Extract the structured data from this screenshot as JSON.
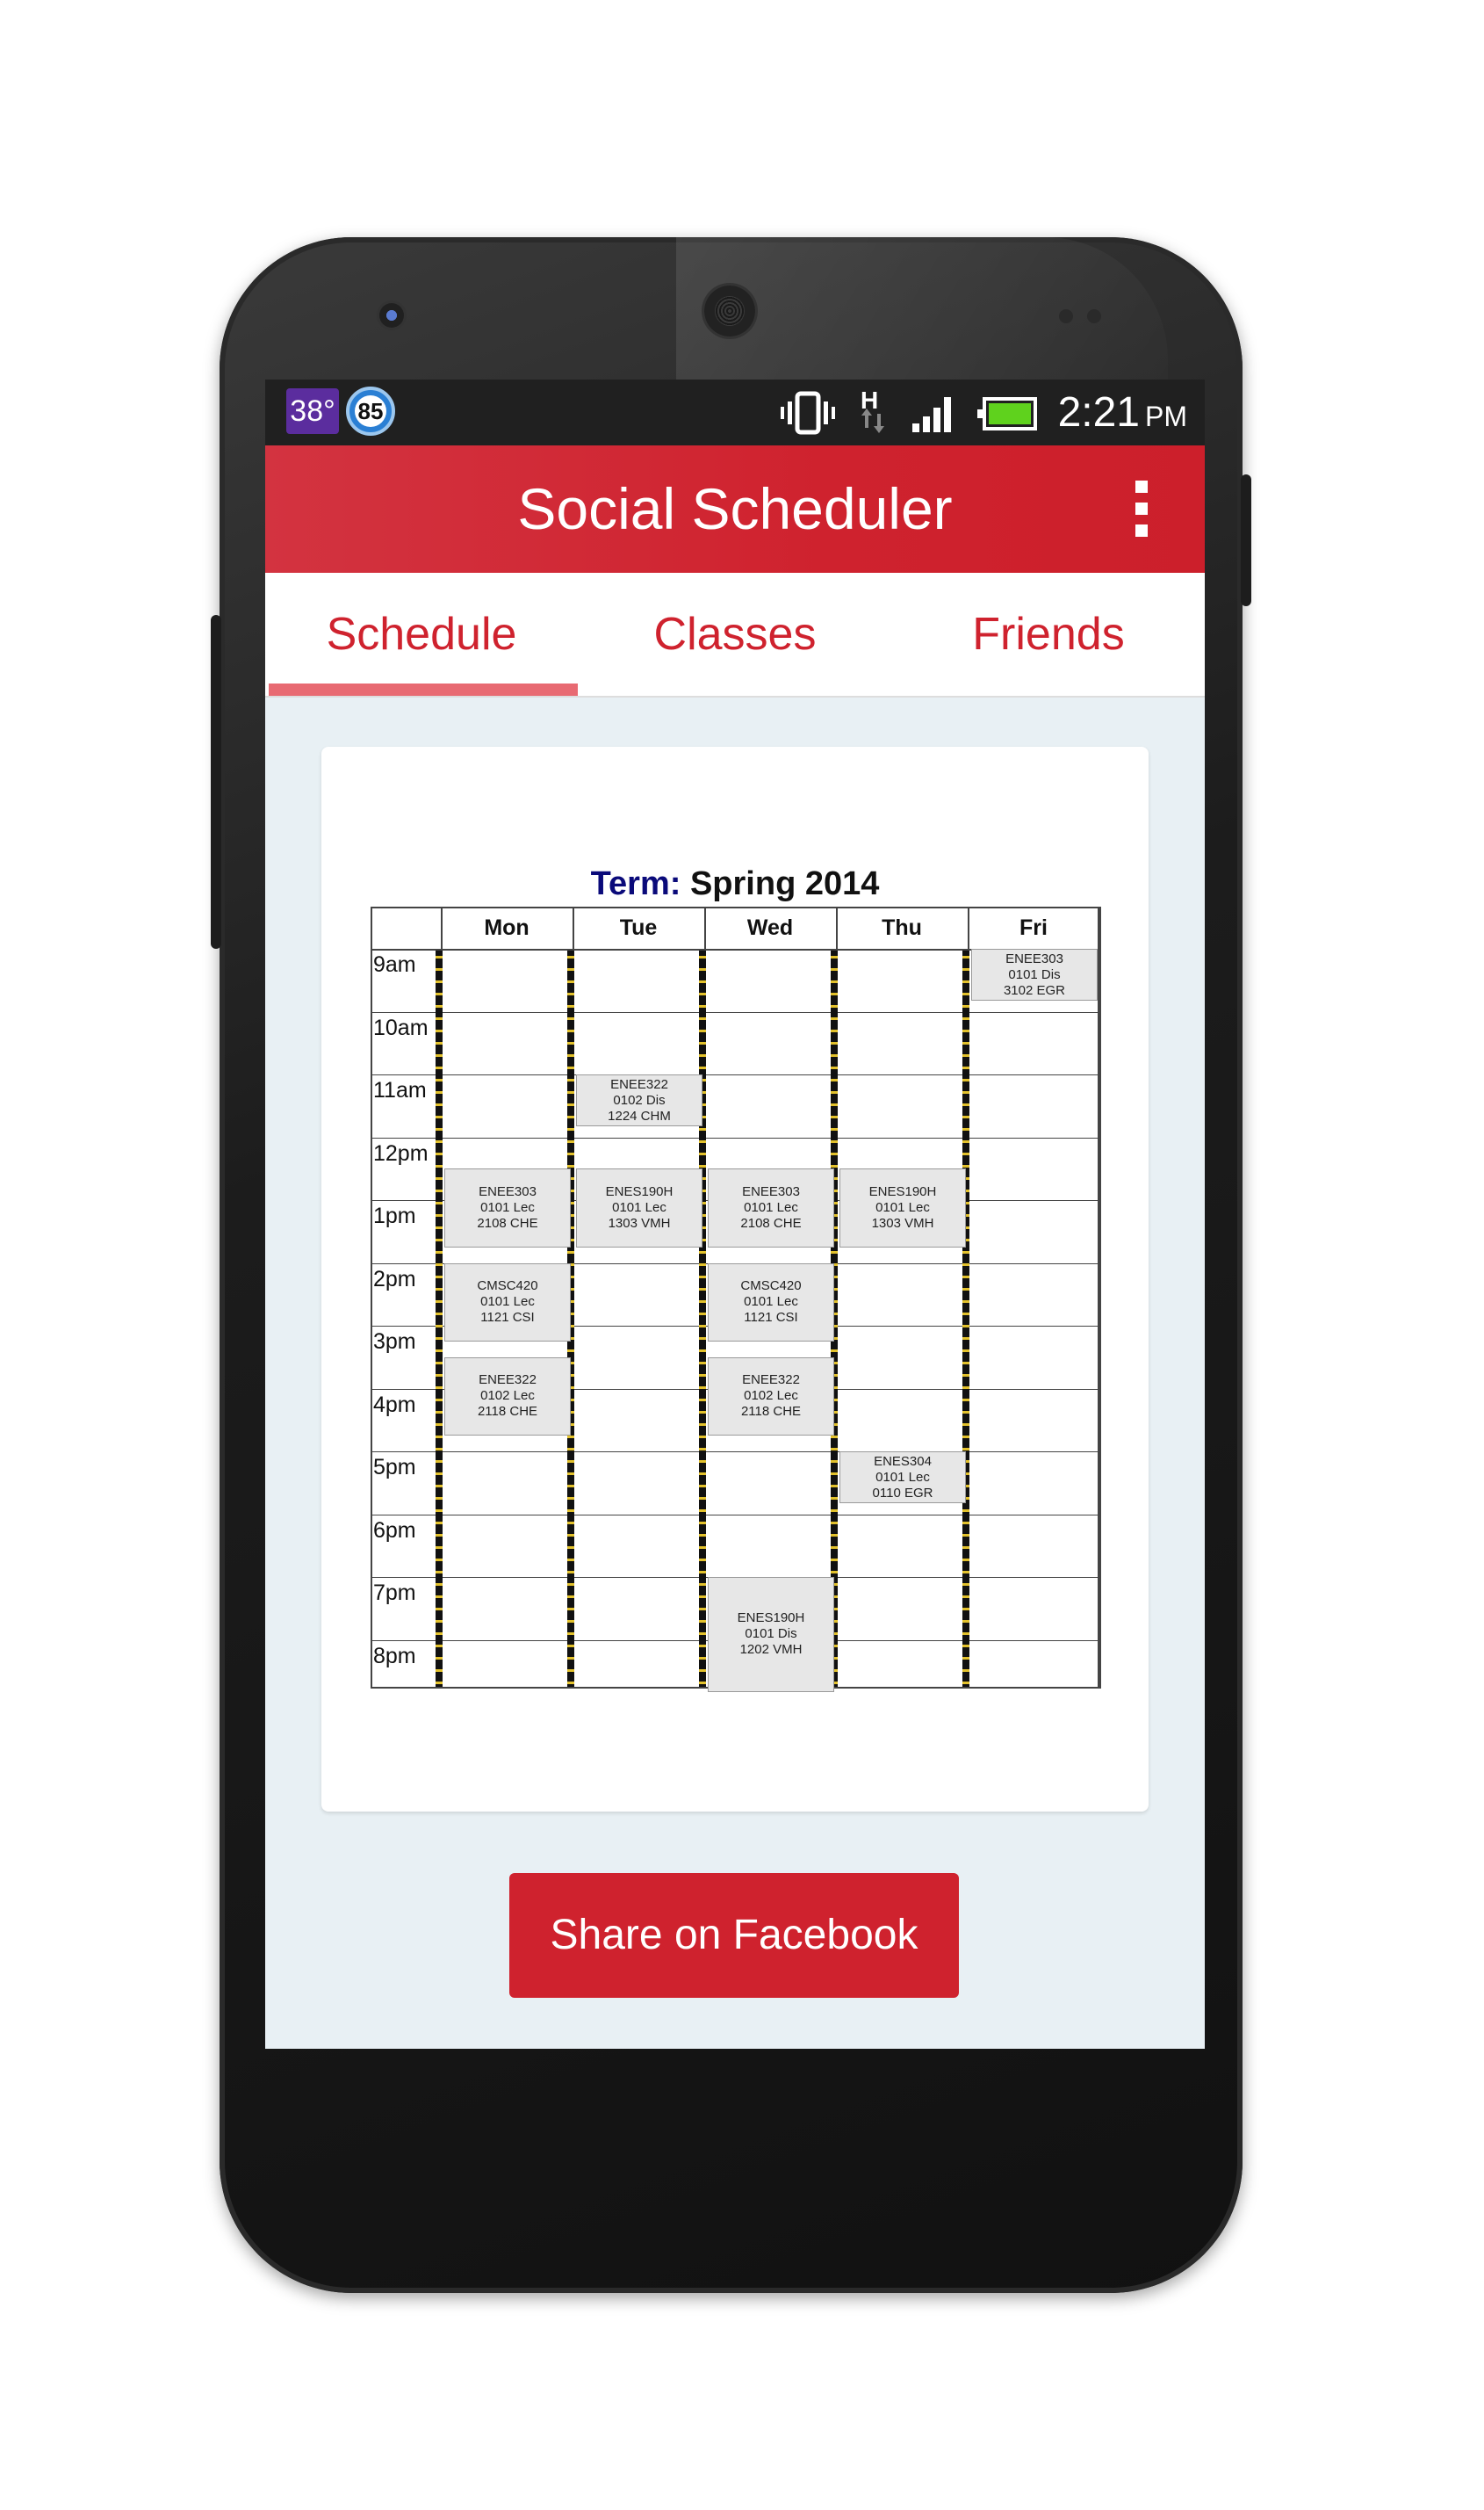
{
  "status_bar": {
    "temperature": "38°",
    "badge": "85",
    "time": "2:21",
    "ampm": "PM",
    "icons": [
      "vibrate-icon",
      "network-h-icon",
      "signal-icon",
      "battery-icon"
    ]
  },
  "app": {
    "title": "Social Scheduler",
    "menu_icon": "overflow-menu-icon"
  },
  "tabs": [
    {
      "label": "Schedule",
      "active": true
    },
    {
      "label": "Classes",
      "active": false
    },
    {
      "label": "Friends",
      "active": false
    }
  ],
  "schedule": {
    "term_label": "Term:",
    "term_value": "Spring 2014",
    "days": [
      "Mon",
      "Tue",
      "Wed",
      "Thu",
      "Fri"
    ],
    "times": [
      "9am",
      "10am",
      "11am",
      "12pm",
      "1pm",
      "2pm",
      "3pm",
      "4pm",
      "5pm",
      "6pm",
      "7pm",
      "8pm"
    ],
    "events": [
      {
        "day": 4,
        "start": 9.0,
        "end": 9.83,
        "lines": [
          "ENEE303",
          "0101 Dis",
          "3102 EGR"
        ]
      },
      {
        "day": 1,
        "start": 11.0,
        "end": 11.83,
        "lines": [
          "ENEE322",
          "0102 Dis",
          "1224 CHM"
        ]
      },
      {
        "day": 0,
        "start": 12.5,
        "end": 13.75,
        "lines": [
          "ENEE303",
          "0101 Lec",
          "2108 CHE"
        ]
      },
      {
        "day": 1,
        "start": 12.5,
        "end": 13.75,
        "lines": [
          "ENES190H",
          "0101 Lec",
          "1303 VMH"
        ]
      },
      {
        "day": 2,
        "start": 12.5,
        "end": 13.75,
        "lines": [
          "ENEE303",
          "0101 Lec",
          "2108 CHE"
        ]
      },
      {
        "day": 3,
        "start": 12.5,
        "end": 13.75,
        "lines": [
          "ENES190H",
          "0101 Lec",
          "1303 VMH"
        ]
      },
      {
        "day": 0,
        "start": 14.0,
        "end": 15.25,
        "lines": [
          "CMSC420",
          "0101 Lec",
          "1121 CSI"
        ]
      },
      {
        "day": 2,
        "start": 14.0,
        "end": 15.25,
        "lines": [
          "CMSC420",
          "0101 Lec",
          "1121 CSI"
        ]
      },
      {
        "day": 0,
        "start": 15.5,
        "end": 16.75,
        "lines": [
          "ENEE322",
          "0102 Lec",
          "2118 CHE"
        ]
      },
      {
        "day": 2,
        "start": 15.5,
        "end": 16.75,
        "lines": [
          "ENEE322",
          "0102 Lec",
          "2118 CHE"
        ]
      },
      {
        "day": 3,
        "start": 17.0,
        "end": 17.83,
        "lines": [
          "ENES304",
          "0101 Lec",
          "0110 EGR"
        ]
      },
      {
        "day": 2,
        "start": 19.0,
        "end": 20.83,
        "lines": [
          "ENES190H",
          "0101 Dis",
          "1202 VMH"
        ]
      }
    ]
  },
  "share_button": "Share on Facebook"
}
